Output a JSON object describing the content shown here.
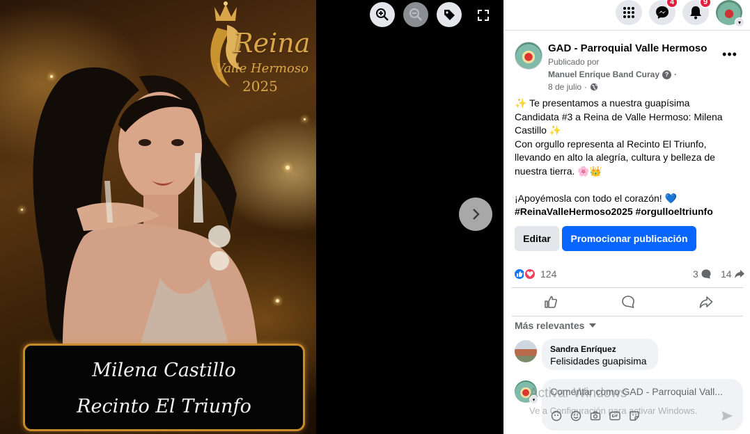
{
  "viewer": {
    "logo": {
      "title": "Reina",
      "subtitle": "Valle Hermoso",
      "year": "2025"
    },
    "nameplate": {
      "line1": "Milena Castillo",
      "line2": "Recinto El Triunfo"
    },
    "controls": [
      "zoom-in-icon",
      "zoom-out-icon",
      "tag-icon",
      "expand-icon",
      "chevron-right-icon"
    ]
  },
  "topbar": {
    "icons": [
      "apps-grid-icon",
      "messenger-icon",
      "bell-icon"
    ],
    "messenger_badge": "4",
    "notifications_badge": "9"
  },
  "post": {
    "page_name": "GAD - Parroquial Valle Hermoso",
    "posted_by_label": "Publicado por",
    "author": "Manuel Enrique Band Curay",
    "date": "8 de julio",
    "text_lines": [
      "✨ Te presentamos a nuestra guapísima",
      "Candidata #3 a Reina de Valle Hermoso: Milena",
      "Castillo ✨",
      "Con orgullo representa al Recinto El Triunfo,",
      "llevando en alto la alegría, cultura y belleza de",
      "nuestra tierra. 🌸👑",
      "",
      "¡Apoyémosla con todo el corazón! 💙"
    ],
    "hashtags": "#ReinaValleHermoso2025 #orgulloeltriunfo",
    "edit_label": "Editar",
    "promote_label": "Promocionar publicación",
    "reaction_count": "124",
    "comment_count": "3",
    "share_count": "14"
  },
  "comments": {
    "sort_label": "Más relevantes",
    "items": [
      {
        "author": "Sandra Enríquez",
        "text": "Felisidades guapisima"
      }
    ],
    "input_placeholder": "Comentar como GAD - Parroquial Vall..."
  },
  "watermark": {
    "title": "Activar Windows",
    "subtitle": "Ve a Configuración para activar Windows."
  },
  "colors": {
    "accent": "#0866ff",
    "like": "#1877f2",
    "love": "#f33e58",
    "badge": "#e41e3f",
    "gold": "#d9a64a"
  }
}
